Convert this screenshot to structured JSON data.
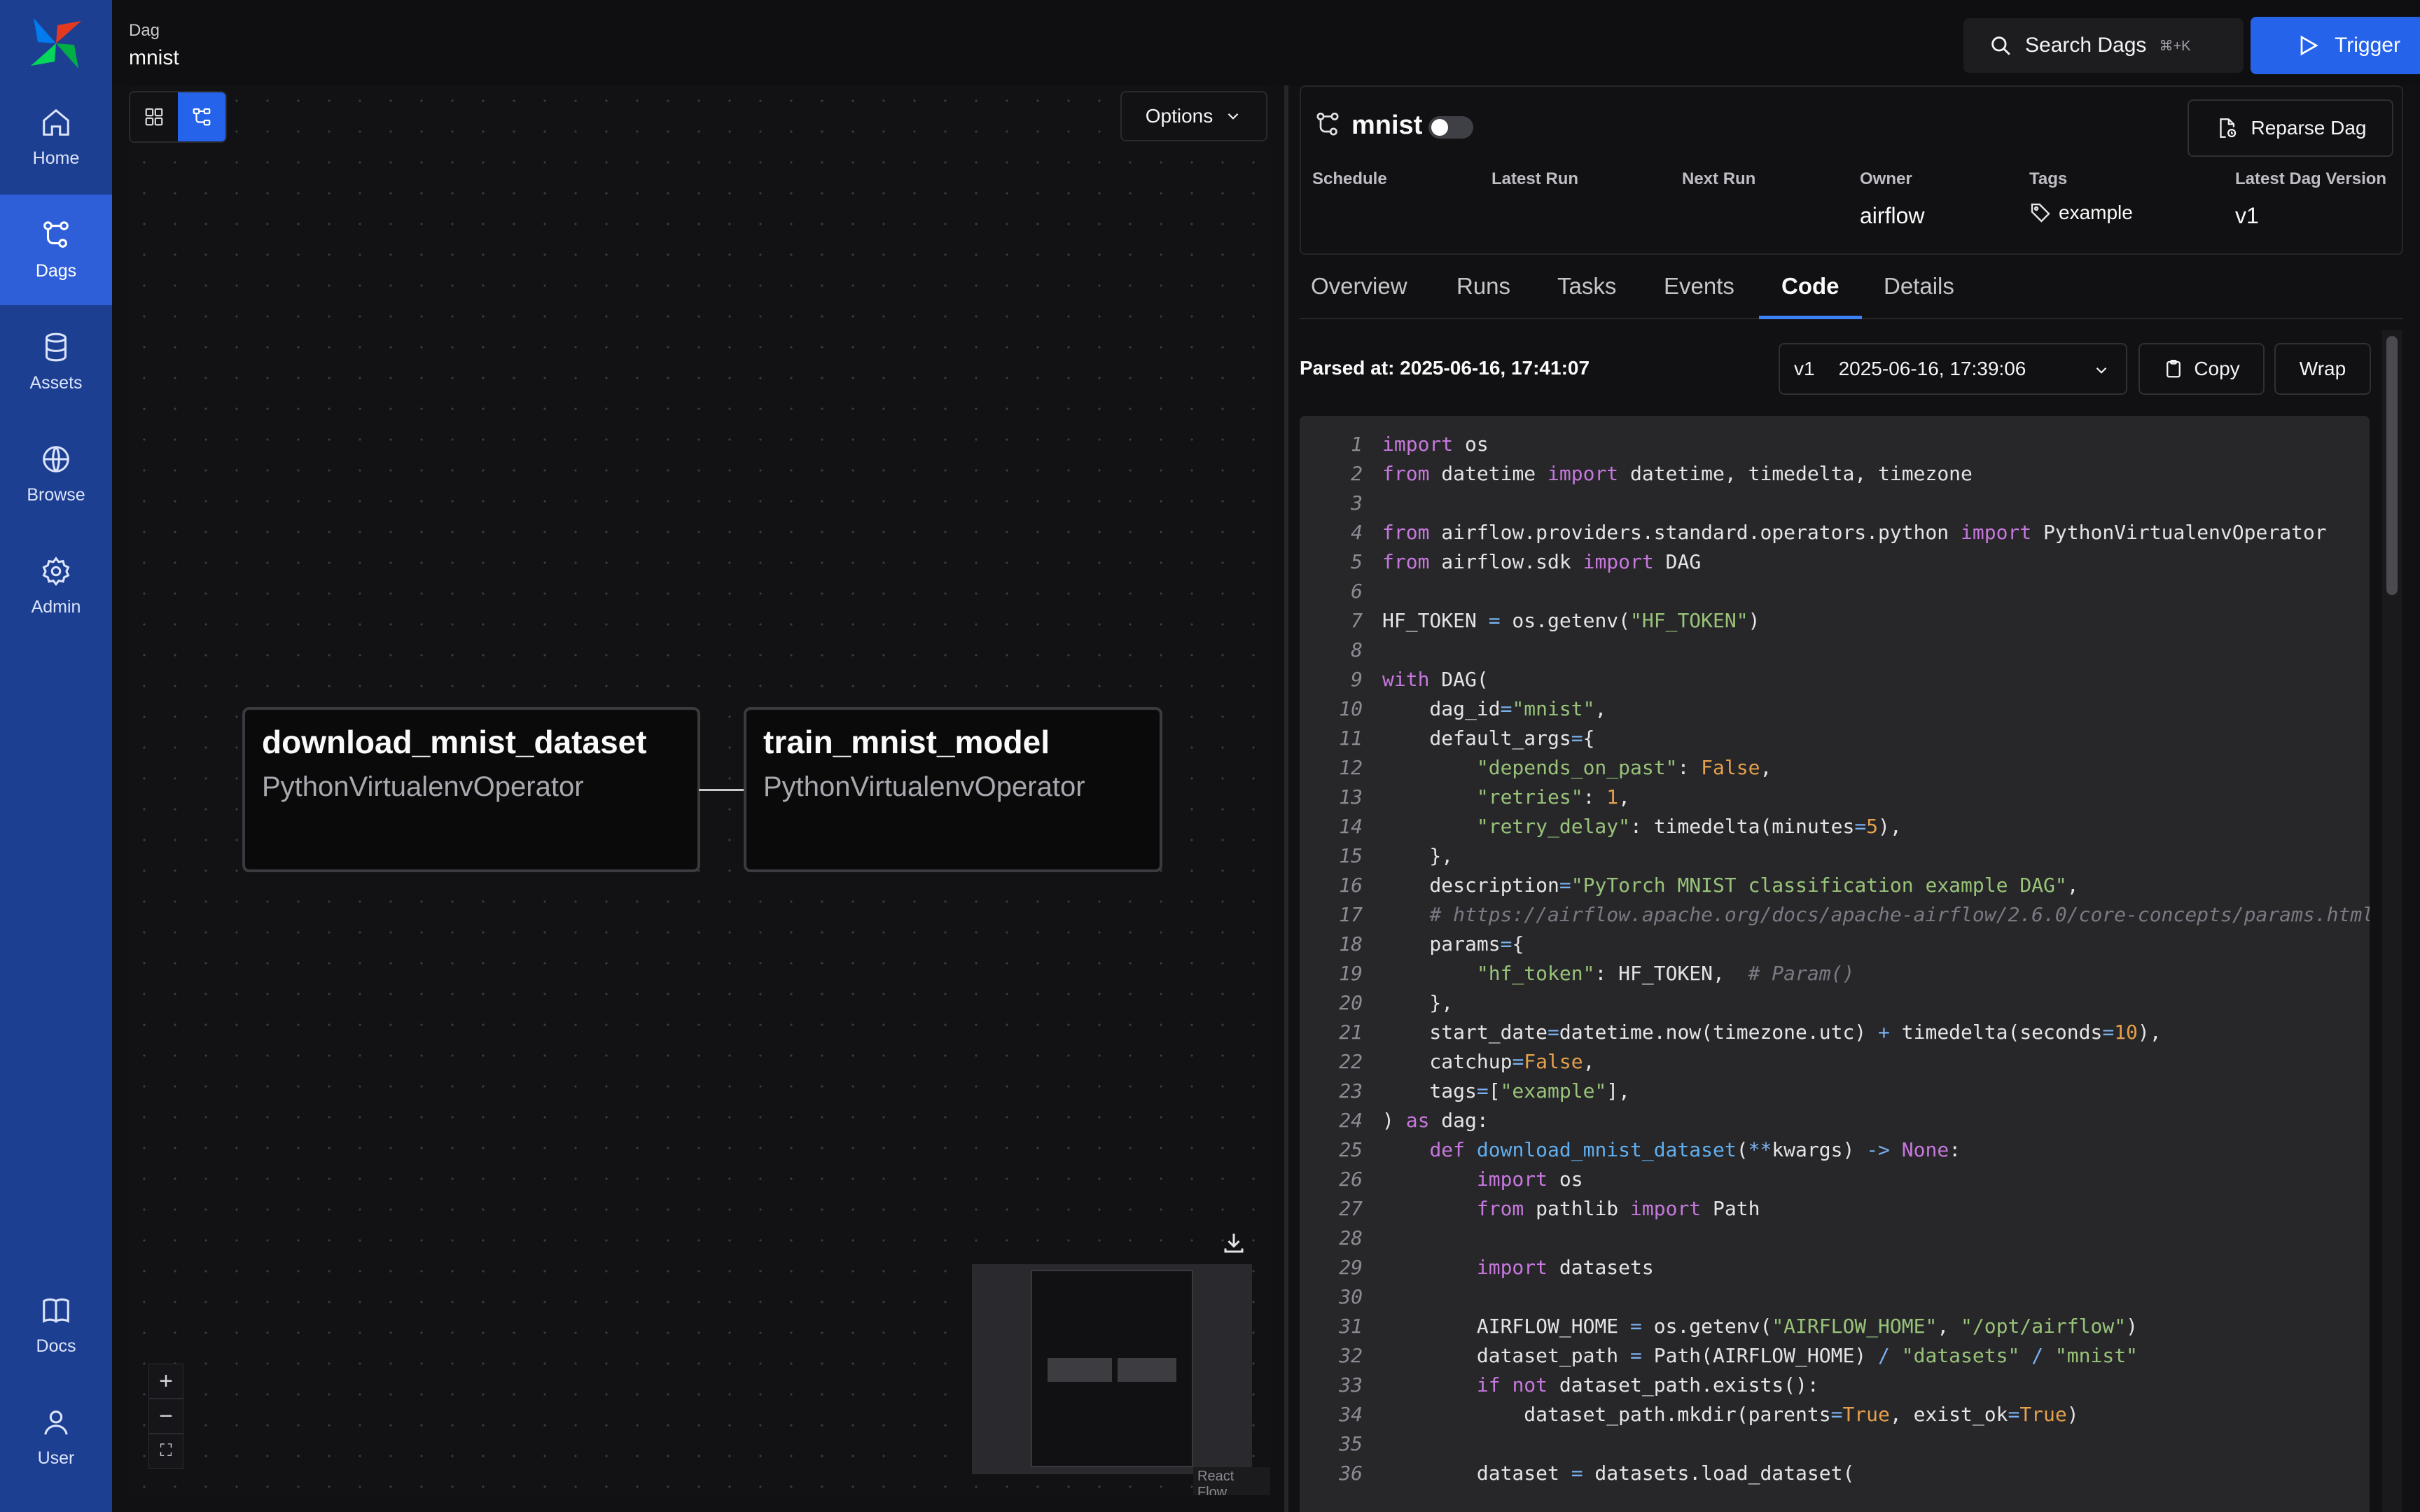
{
  "sidebar": {
    "items": [
      {
        "label": "Home",
        "icon": "home-icon"
      },
      {
        "label": "Dags",
        "icon": "dags-icon",
        "active": true
      },
      {
        "label": "Assets",
        "icon": "database-icon"
      },
      {
        "label": "Browse",
        "icon": "globe-icon"
      },
      {
        "label": "Admin",
        "icon": "gear-icon"
      },
      {
        "label": "Docs",
        "icon": "book-icon"
      },
      {
        "label": "User",
        "icon": "user-icon"
      }
    ]
  },
  "header": {
    "breadcrumb_label": "Dag",
    "breadcrumb_value": "mnist",
    "search_label": "Search Dags",
    "search_shortcut": "⌘+K",
    "trigger_label": "Trigger"
  },
  "graph": {
    "options_label": "Options",
    "nodes": [
      {
        "title": "download_mnist_dataset",
        "type": "PythonVirtualenvOperator"
      },
      {
        "title": "train_mnist_model",
        "type": "PythonVirtualenvOperator"
      }
    ],
    "attribution": "React Flow",
    "zoom_in": "+",
    "zoom_out": "−",
    "fit_view": "⛶"
  },
  "dag": {
    "name": "mnist",
    "reparse_label": "Reparse Dag",
    "meta": {
      "schedule_label": "Schedule",
      "latest_run_label": "Latest Run",
      "next_run_label": "Next Run",
      "owner_label": "Owner",
      "owner_value": "airflow",
      "tags_label": "Tags",
      "tags_value": "example",
      "version_label": "Latest Dag Version",
      "version_value": "v1"
    }
  },
  "tabs": [
    "Overview",
    "Runs",
    "Tasks",
    "Events",
    "Code",
    "Details"
  ],
  "active_tab": "Code",
  "code_toolbar": {
    "parsed_at": "Parsed at: 2025-06-16, 17:41:07",
    "version": "v1",
    "version_date": "2025-06-16, 17:39:06",
    "copy_label": "Copy",
    "wrap_label": "Wrap"
  },
  "code_lines": [
    "import os",
    "from datetime import datetime, timedelta, timezone",
    "",
    "from airflow.providers.standard.operators.python import PythonVirtualenvOperator",
    "from airflow.sdk import DAG",
    "",
    "HF_TOKEN = os.getenv(\"HF_TOKEN\")",
    "",
    "with DAG(",
    "    dag_id=\"mnist\",",
    "    default_args={",
    "        \"depends_on_past\": False,",
    "        \"retries\": 1,",
    "        \"retry_delay\": timedelta(minutes=5),",
    "    },",
    "    description=\"PyTorch MNIST classification example DAG\",",
    "    # https://airflow.apache.org/docs/apache-airflow/2.6.0/core-concepts/params.html",
    "    params={",
    "        \"hf_token\": HF_TOKEN,  # Param()",
    "    },",
    "    start_date=datetime.now(timezone.utc) + timedelta(seconds=10),",
    "    catchup=False,",
    "    tags=[\"example\"],",
    ") as dag:",
    "    def download_mnist_dataset(**kwargs) -> None:",
    "        import os",
    "        from pathlib import Path",
    "",
    "        import datasets",
    "",
    "        AIRFLOW_HOME = os.getenv(\"AIRFLOW_HOME\", \"/opt/airflow\")",
    "        dataset_path = Path(AIRFLOW_HOME) / \"datasets\" / \"mnist\"",
    "        if not dataset_path.exists():",
    "            dataset_path.mkdir(parents=True, exist_ok=True)",
    "",
    "        dataset = datasets.load_dataset("
  ],
  "colors": {
    "sidebar": "#1d3f91",
    "sidebar_active": "#2f5fd8",
    "accent": "#2563eb",
    "keyword": "#c678dd",
    "string": "#98c379",
    "number": "#e5a04b",
    "comment": "#7a7a84"
  }
}
